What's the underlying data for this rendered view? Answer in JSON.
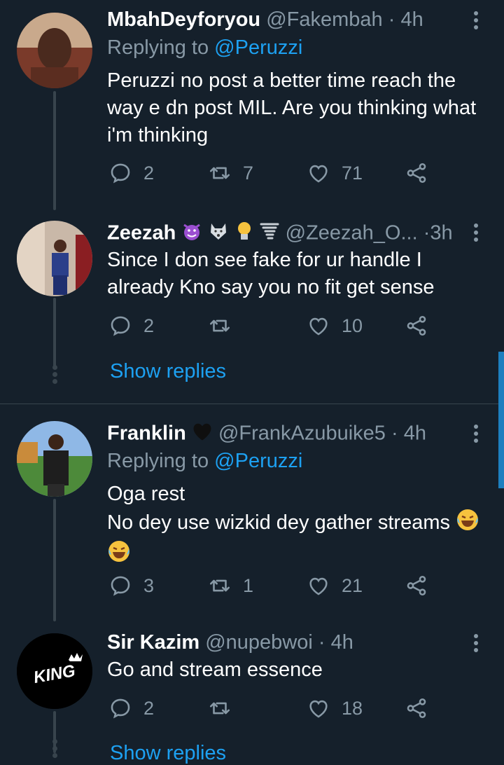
{
  "tweets": [
    {
      "name": "MbahDeyforyou",
      "handle": "@Fakembah",
      "time": "4h",
      "reply_prefix": "Replying to",
      "reply_to": "@Peruzzi",
      "text_lines": [
        "Peruzzi no post a better time reach the",
        "way e dn post MIL. Are you thinking what",
        "i'm thinking"
      ],
      "replies": "2",
      "retweets": "7",
      "likes": "71"
    },
    {
      "name": "Zeezah",
      "handle": "@Zeezah_O...",
      "time": "3h",
      "text_lines": [
        "Since I don see fake for ur handle I",
        "already Kno say you no fit get sense"
      ],
      "replies": "2",
      "retweets": "",
      "likes": "10",
      "show_replies": "Show replies"
    },
    {
      "name": "Franklin",
      "handle": "@FrankAzubuike5",
      "time": "4h",
      "reply_prefix": "Replying to",
      "reply_to": "@Peruzzi",
      "text_lines": [
        "Oga rest",
        "No dey use wizkid dey gather streams"
      ],
      "replies": "3",
      "retweets": "1",
      "likes": "21"
    },
    {
      "name": "Sir Kazim",
      "handle": "@nupebwoi",
      "time": "4h",
      "text_lines": [
        "Go and stream essence"
      ],
      "replies": "2",
      "retweets": "",
      "likes": "18",
      "show_replies": "Show replies",
      "avatar_text": "KING"
    }
  ],
  "icons": {
    "reply": "reply-icon",
    "retweet": "retweet-icon",
    "like": "heart-icon",
    "share": "share-icon",
    "more": "more-vertical-icon"
  },
  "colors": {
    "background": "#15202b",
    "accent": "#1da1f2",
    "muted": "#8899a6",
    "line": "#38444d"
  }
}
